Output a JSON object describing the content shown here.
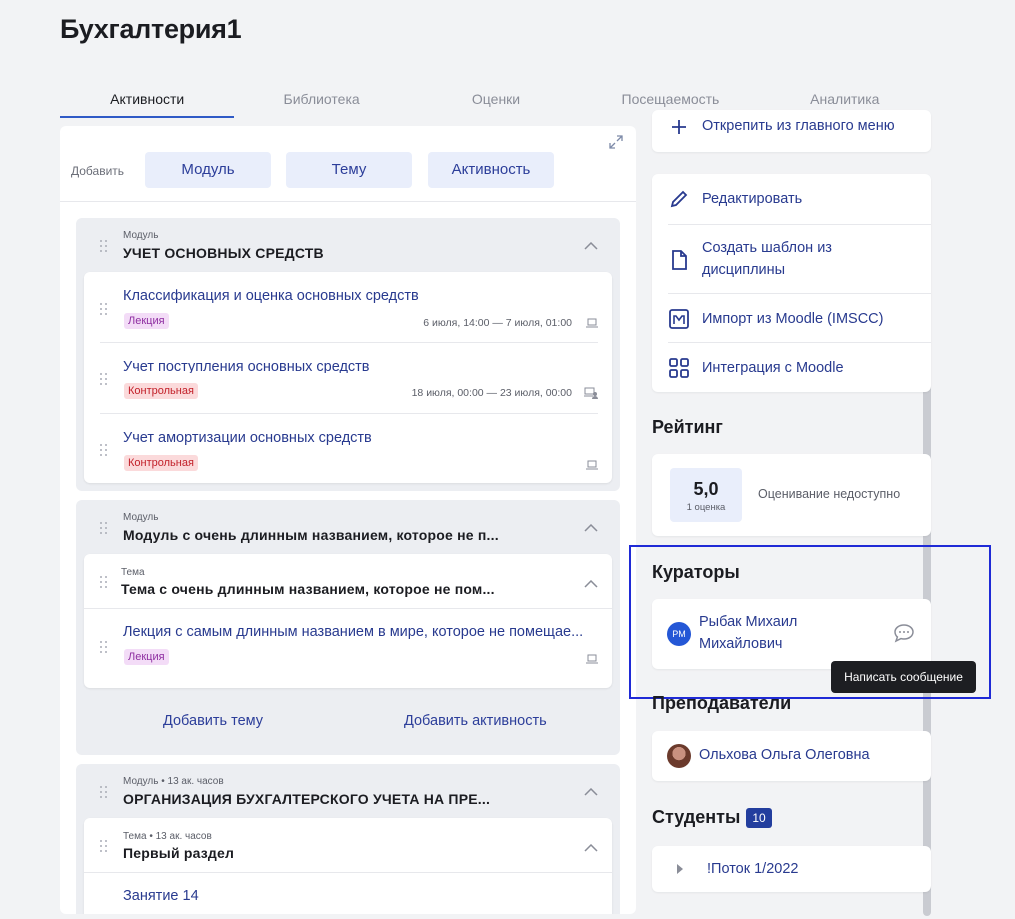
{
  "page": {
    "title": "Бухгалтерия1"
  },
  "tabs": [
    {
      "label": "Активности",
      "active": true
    },
    {
      "label": "Библиотека"
    },
    {
      "label": "Оценки"
    },
    {
      "label": "Посещаемость"
    },
    {
      "label": "Аналитика"
    }
  ],
  "add_bar": {
    "label": "Добавить",
    "buttons": [
      "Модуль",
      "Тему",
      "Активность"
    ]
  },
  "modules": [
    {
      "subtitle": "Модуль",
      "title": "УЧЕТ ОСНОВНЫХ СРЕДСТВ",
      "items": [
        {
          "title": "Классификация и оценка основных средств",
          "badge": "Лекция",
          "date": "6 июля, 14:00 — 7 июля, 01:00"
        },
        {
          "title": "Учет поступления основных средств",
          "badge": "Контрольная",
          "date": "18 июля, 00:00 — 23 июля, 00:00"
        },
        {
          "title": "Учет амортизации основных средств",
          "badge": "Контрольная",
          "date": ""
        }
      ]
    },
    {
      "subtitle": "Модуль",
      "title": "Модуль с очень длинным названием, которое не п...",
      "topic": {
        "subtitle": "Тема",
        "title": "Тема с очень длинным названием, которое не пом...",
        "item": {
          "title": "Лекция с самым длинным названием в мире, которое не помещае...",
          "badge": "Лекция"
        }
      },
      "actions": [
        "Добавить тему",
        "Добавить активность"
      ]
    },
    {
      "subtitle": "Модуль • 13 ак. часов",
      "title": "ОРГАНИЗАЦИЯ БУХГАЛТЕРСКОГО УЧЕТА НА ПРЕ...",
      "topic": {
        "subtitle": "Тема • 13 ак. часов",
        "title": "Первый раздел",
        "item": {
          "title": "Занятие 14"
        }
      }
    }
  ],
  "sidebar": {
    "top_item": "Открепить из главного меню",
    "menu": [
      {
        "label": "Редактировать",
        "icon": "pencil-icon"
      },
      {
        "label": "Создать шаблон из дисциплины",
        "icon": "file-icon"
      },
      {
        "label": "Импорт из Moodle (IMSCC)",
        "icon": "moodle-m-icon"
      },
      {
        "label": "Интеграция с Moodle",
        "icon": "grid-icon"
      }
    ],
    "rating": {
      "title": "Рейтинг",
      "value": "5,0",
      "count": "1 оценка",
      "note": "Оценивание недоступно"
    },
    "curators": {
      "title": "Кураторы",
      "name": "Рыбак Михаил Михайлович",
      "initials": "РМ",
      "tooltip": "Написать сообщение"
    },
    "teachers": {
      "title": "Преподаватели",
      "name": "Ольхова Ольга Олеговна"
    },
    "students": {
      "title": "Студенты",
      "count": "10",
      "group": "!Поток 1/2022"
    }
  },
  "colors": {
    "accent": "#2f5ac6",
    "link": "#283a8f",
    "highlight": "#1f2ad6"
  }
}
